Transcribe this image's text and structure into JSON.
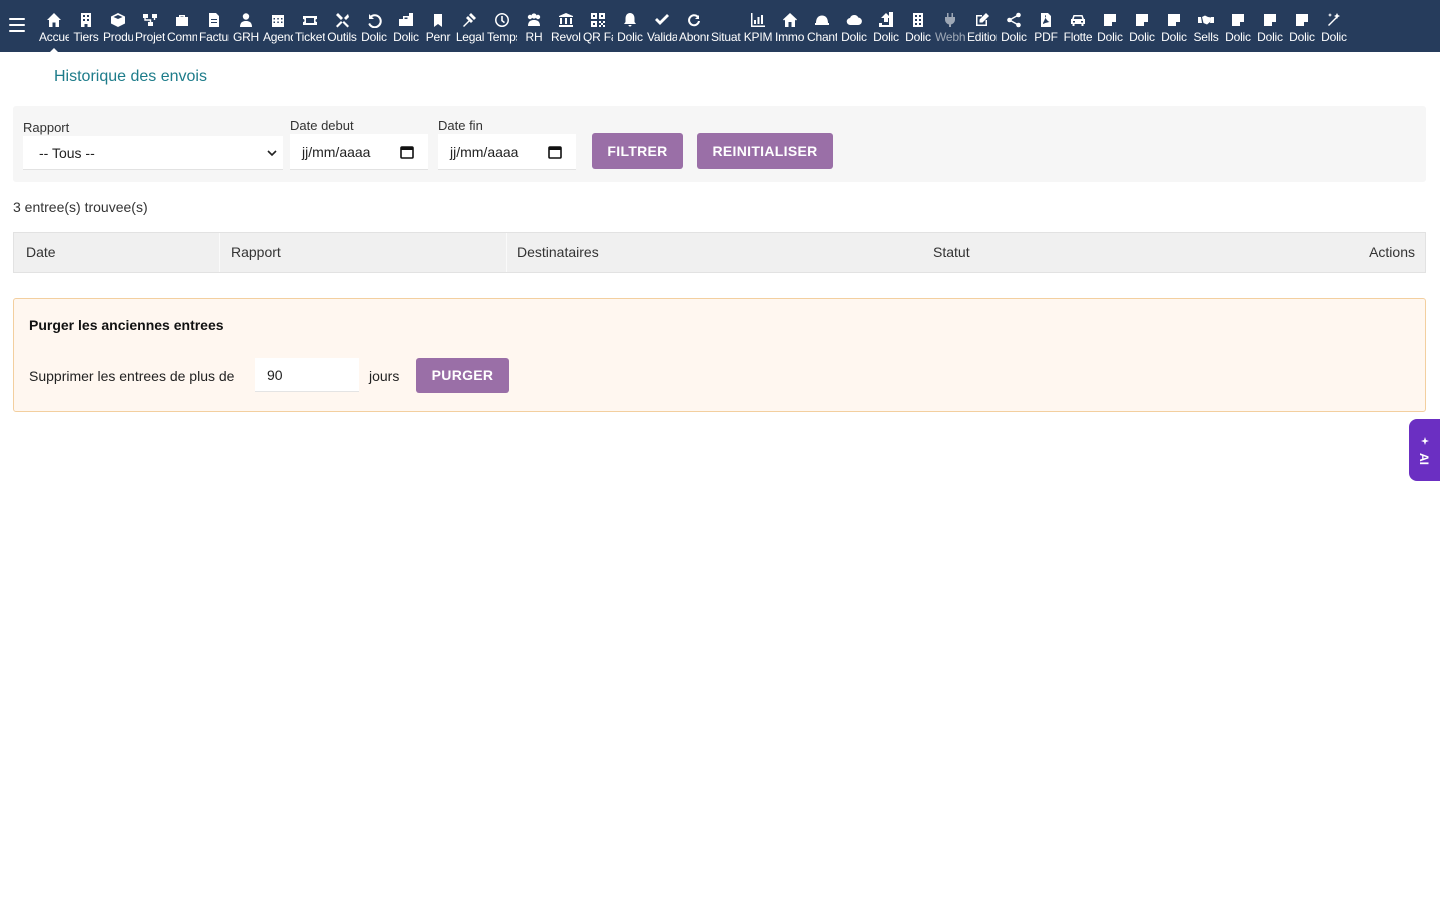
{
  "topbar": {
    "menu_items": [
      {
        "label": "Accueil",
        "icon": "home-icon"
      },
      {
        "label": "Tiers",
        "icon": "building-icon"
      },
      {
        "label": "Produits",
        "icon": "cube-icon"
      },
      {
        "label": "Projets",
        "icon": "sitemap-icon"
      },
      {
        "label": "Commercial",
        "icon": "briefcase-icon"
      },
      {
        "label": "Facturation",
        "icon": "invoice-icon"
      },
      {
        "label": "GRH",
        "icon": "user-tie-icon"
      },
      {
        "label": "Agenda",
        "icon": "calendar-icon"
      },
      {
        "label": "Tickets",
        "icon": "ticket-icon"
      },
      {
        "label": "Outils",
        "icon": "tools-icon"
      },
      {
        "label": "Dolic",
        "icon": "undo-icon"
      },
      {
        "label": "Dolic",
        "icon": "toolbox-icon"
      },
      {
        "label": "Penr",
        "icon": "bookmark-icon"
      },
      {
        "label": "Legal",
        "icon": "gavel-icon"
      },
      {
        "label": "Temps",
        "icon": "clock-icon"
      },
      {
        "label": "RH",
        "icon": "users-icon"
      },
      {
        "label": "Revolut",
        "icon": "bank-icon"
      },
      {
        "label": "QR Factures",
        "icon": "qrcode-icon"
      },
      {
        "label": "Dolic",
        "icon": "bell-icon"
      },
      {
        "label": "Validation",
        "icon": "double-check-icon"
      },
      {
        "label": "Abonnements",
        "icon": "refresh-icon"
      },
      {
        "label": "Situation",
        "icon": "blank-icon"
      },
      {
        "label": "KPIM",
        "icon": "bar-chart-icon"
      },
      {
        "label": "Immobilier",
        "icon": "house-icon"
      },
      {
        "label": "Chantier",
        "icon": "hard-hat-icon"
      },
      {
        "label": "Dolic",
        "icon": "cloud-icon"
      },
      {
        "label": "Dolic",
        "icon": "upload-icon"
      },
      {
        "label": "Dolic",
        "icon": "office-building-icon"
      },
      {
        "label": "Webhook",
        "icon": "plug-icon"
      },
      {
        "label": "Edition",
        "icon": "edit-icon"
      },
      {
        "label": "Dolic",
        "icon": "share-icon"
      },
      {
        "label": "PDF",
        "icon": "pdf-file-icon"
      },
      {
        "label": "Flotte",
        "icon": "car-icon"
      },
      {
        "label": "Dolic",
        "icon": "note-icon"
      },
      {
        "label": "Dolic",
        "icon": "note-icon"
      },
      {
        "label": "Dolic",
        "icon": "note-icon"
      },
      {
        "label": "Sells",
        "icon": "handshake-icon"
      },
      {
        "label": "Dolic",
        "icon": "note-icon"
      },
      {
        "label": "Dolic",
        "icon": "note-icon"
      },
      {
        "label": "Dolic",
        "icon": "note-icon"
      },
      {
        "label": "Dolic",
        "icon": "magic-wand-icon"
      }
    ]
  },
  "page": {
    "title": "Historique des envois"
  },
  "filters": {
    "report_label": "Rapport",
    "report_value": "-- Tous --",
    "start_label": "Date debut",
    "start_placeholder": "jj/mm/aaaa",
    "end_label": "Date fin",
    "end_placeholder": "jj/mm/aaaa",
    "filter_button": "FILTRER",
    "reset_button": "REINITIALISER"
  },
  "results": {
    "count_text": "3 entree(s) trouvee(s)"
  },
  "table": {
    "headers": [
      "Date",
      "Rapport",
      "Destinataires",
      "Statut",
      "Actions"
    ]
  },
  "purge": {
    "title": "Purger les anciennes entrees",
    "text_before": "Supprimer les entrees de plus de",
    "days_value": "90",
    "text_after": "jours",
    "button": "PURGER"
  },
  "ai_tab": {
    "label": "AI"
  },
  "colors": {
    "topbar": "#263c5c",
    "accent_button": "#9a6fa7",
    "title_link": "#1d7c8a",
    "purge_bg": "#fff7f0",
    "purge_border": "#f3cf9f",
    "ai_tab": "#6b2fc2"
  }
}
